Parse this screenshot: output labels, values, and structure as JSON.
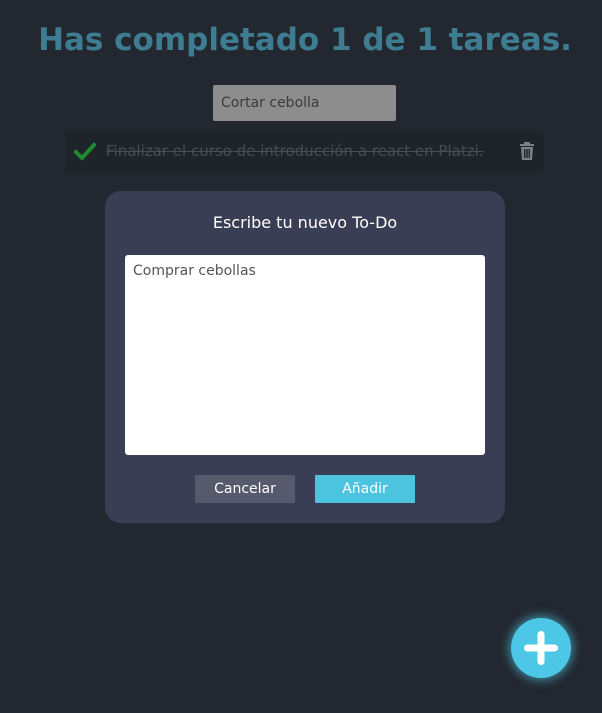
{
  "header": {
    "counter_text": "Has completado 1 de 1 tareas."
  },
  "search": {
    "placeholder": "Cortar cebolla"
  },
  "todos": [
    {
      "text": "Finalizar el curso de introducción a react en Platzi.",
      "completed": true,
      "check_icon": "check-icon",
      "delete_icon": "trash-icon"
    }
  ],
  "modal": {
    "title": "Escribe tu nuevo To-Do",
    "textarea_value": "Comprar cebollas",
    "cancel_label": "Cancelar",
    "add_label": "Añadir"
  },
  "fab": {
    "icon": "plus-icon"
  },
  "colors": {
    "background": "#23272f",
    "title": "#3e7d91",
    "accent": "#4cc8e6",
    "check": "#1f8a2e",
    "modal": "#3a3e54"
  }
}
